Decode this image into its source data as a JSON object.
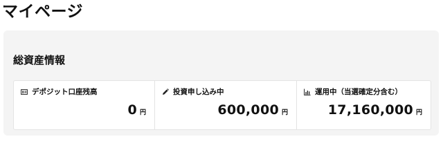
{
  "page": {
    "title": "マイページ"
  },
  "summary": {
    "title": "総資産情報",
    "cards": [
      {
        "icon": "id-card-icon",
        "label": "デポジット口座残高",
        "amount": "0",
        "unit": "円"
      },
      {
        "icon": "pencil-icon",
        "label": "投資申し込み中",
        "amount": "600,000",
        "unit": "円"
      },
      {
        "icon": "bar-chart-icon",
        "label": "運用中（当選確定分含む）",
        "amount": "17,160,000",
        "unit": "円"
      }
    ]
  }
}
